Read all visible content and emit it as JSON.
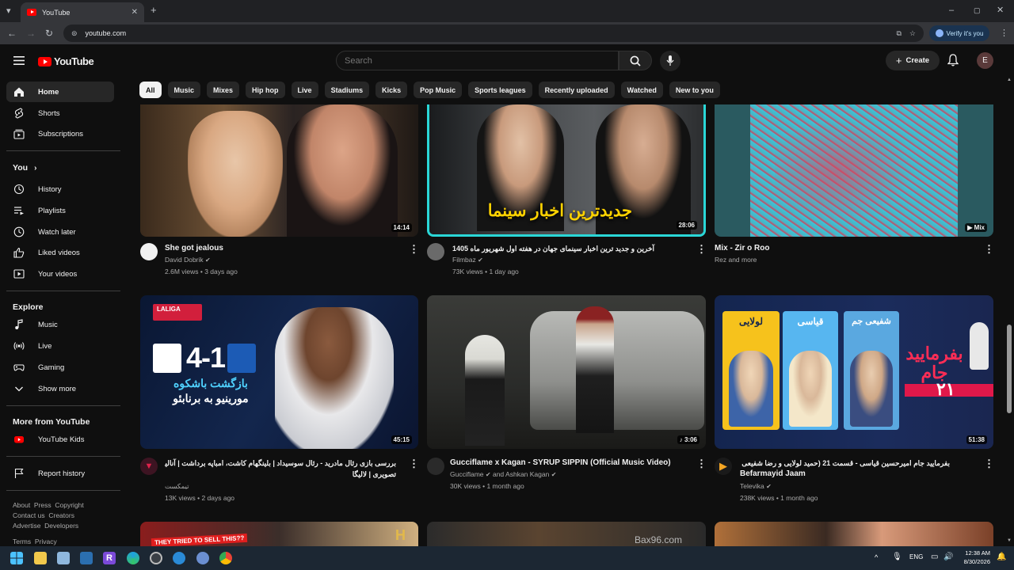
{
  "browser": {
    "tab_title": "YouTube",
    "url": "youtube.com",
    "verify_label": "Verify it's you"
  },
  "header": {
    "logo_text": "YouTube",
    "search_placeholder": "Search",
    "create_label": "Create",
    "avatar_letter": "E"
  },
  "sidebar": {
    "main": [
      {
        "label": "Home",
        "icon": "home-icon"
      },
      {
        "label": "Shorts",
        "icon": "shorts-icon"
      },
      {
        "label": "Subscriptions",
        "icon": "subscriptions-icon"
      }
    ],
    "you_heading": "You",
    "you": [
      {
        "label": "History",
        "icon": "history-icon"
      },
      {
        "label": "Playlists",
        "icon": "playlists-icon"
      },
      {
        "label": "Watch later",
        "icon": "clock-icon"
      },
      {
        "label": "Liked videos",
        "icon": "thumbs-up-icon"
      },
      {
        "label": "Your videos",
        "icon": "video-icon"
      }
    ],
    "explore_heading": "Explore",
    "explore": [
      {
        "label": "Music",
        "icon": "music-icon"
      },
      {
        "label": "Live",
        "icon": "live-icon"
      },
      {
        "label": "Gaming",
        "icon": "gaming-icon"
      },
      {
        "label": "Show more",
        "icon": "chevron-down-icon"
      }
    ],
    "more_heading": "More from YouTube",
    "more": [
      {
        "label": "YouTube Kids",
        "icon": "youtube-kids-icon"
      }
    ],
    "report": {
      "label": "Report history",
      "icon": "flag-icon"
    },
    "footer_line1": "About  Press  Copyright",
    "footer_line2": "Contact us  Creators",
    "footer_line3": "Advertise  Developers",
    "footer_line4": "Terms  Privacy"
  },
  "chips": [
    "All",
    "Music",
    "Mixes",
    "Hip hop",
    "Live",
    "Stadiums",
    "Kicks",
    "Pop Music",
    "Sports leagues",
    "Recently uploaded",
    "Watched",
    "New to you"
  ],
  "videos": [
    {
      "title": "She got jealous",
      "channel": "David Dobrik",
      "meta": "2.6M views • 3 days ago",
      "duration": "14:14"
    },
    {
      "title": "آخرین و جدید ترین اخبار سینمای جهان در هفته اول شهریور ماه 1405",
      "channel": "Filmbaz",
      "meta": "73K views • 1 day ago",
      "duration": "28:06",
      "overlay": "جدیدترین اخبار سینما"
    },
    {
      "title": "Mix - Zir o Roo",
      "channel": "Rez and more",
      "meta": "",
      "duration": "Mix"
    },
    {
      "title_line1": "بررسی بازی رئال مادرید - رئال سوسیداد | بلینگهام کاشت، امباپه برداشت | آنالیز",
      "title_line2": "تصویری | لالیگا",
      "channel": "تیمکست",
      "meta": "13K views • 2 days ago",
      "duration": "45:15",
      "score": "4-1",
      "overlay1": "بازگشت باشکوه",
      "overlay2": "مورینیو به برنابئو",
      "league": "LALIGA"
    },
    {
      "title": "Gucciflame x Kagan - SYRUP SIPPIN (Official Music Video)",
      "channel": "Gucciflame",
      "channel2": "and Ashkan Kagan",
      "meta": "30K views • 1 month ago",
      "duration": "3:06"
    },
    {
      "title_line1": "بفرمایید جام امیرحسین قیاسی - قسمت 21 (حمید لولایی و رضا شفیعی جم) |",
      "title_line2": "Befarmayid Jaam",
      "channel": "Televika",
      "meta": "238K views • 1 month ago",
      "duration": "51:38",
      "overlay": "بفرمایید جام",
      "episode": "۲۱",
      "name1": "لولایی",
      "name2": "قیاسی",
      "name3": "شفیعی جم"
    }
  ],
  "row3_overlay": "THEY TRIED TO SELL THIS??",
  "row3_watermark": "Bax96.com",
  "taskbar": {
    "lang": "ENG",
    "time": "12:38 AM",
    "date": "8/30/2026"
  },
  "colors": {
    "brand_red": "#ff0000",
    "background": "#0f0f0f",
    "chip_bg": "#272727"
  }
}
